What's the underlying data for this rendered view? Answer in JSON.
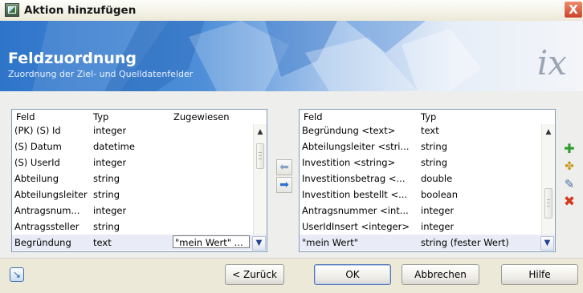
{
  "window": {
    "title": "Aktion hinzufügen",
    "close_label": "X"
  },
  "banner": {
    "title": "Feldzuordnung",
    "subtitle": "Zuordnung der Ziel- und Quelldatenfelder",
    "logo": "ix"
  },
  "left_table": {
    "headers": [
      "Feld",
      "Typ",
      "Zugewiesen"
    ],
    "rows": [
      {
        "feld": "(PK) (S) Id",
        "typ": "integer",
        "zugewiesen": ""
      },
      {
        "feld": "(S) Datum",
        "typ": "datetime",
        "zugewiesen": ""
      },
      {
        "feld": "(S) UserId",
        "typ": "integer",
        "zugewiesen": ""
      },
      {
        "feld": "Abteilung",
        "typ": "string",
        "zugewiesen": ""
      },
      {
        "feld": "Abteilungsleiter",
        "typ": "string",
        "zugewiesen": ""
      },
      {
        "feld": "Antragsnum...",
        "typ": "integer",
        "zugewiesen": ""
      },
      {
        "feld": "Antragssteller",
        "typ": "string",
        "zugewiesen": ""
      },
      {
        "feld": "Begründung",
        "typ": "text",
        "zugewiesen": "\"mein Wert\" ..."
      }
    ]
  },
  "right_table": {
    "headers": [
      "Feld",
      "Typ"
    ],
    "rows": [
      {
        "feld": "Begründung <text>",
        "typ": "text"
      },
      {
        "feld": "Abteilungsleiter <stri...",
        "typ": "string"
      },
      {
        "feld": "Investition <string>",
        "typ": "string"
      },
      {
        "feld": "Investitionsbetrag <...",
        "typ": "double"
      },
      {
        "feld": "Investition bestellt <...",
        "typ": "boolean"
      },
      {
        "feld": "Antragsnummer <int...",
        "typ": "integer"
      },
      {
        "feld": "UserIdInsert <integer>",
        "typ": "integer"
      },
      {
        "feld": "\"mein Wert\"",
        "typ": "string (fester Wert)"
      }
    ]
  },
  "footer": {
    "back": "< Zurück",
    "ok": "OK",
    "cancel": "Abbrechen",
    "help": "Hilfe"
  },
  "icons": {
    "add": "plus-icon",
    "add_multiple": "add-multiple-icon",
    "edit": "edit-icon",
    "delete": "delete-icon",
    "move_left": "arrow-left-icon",
    "move_right": "arrow-right-icon"
  },
  "colors": {
    "banner_blue": "#2e74c9",
    "selection_row": "#e9ecf6",
    "close_red": "#c8452a"
  }
}
